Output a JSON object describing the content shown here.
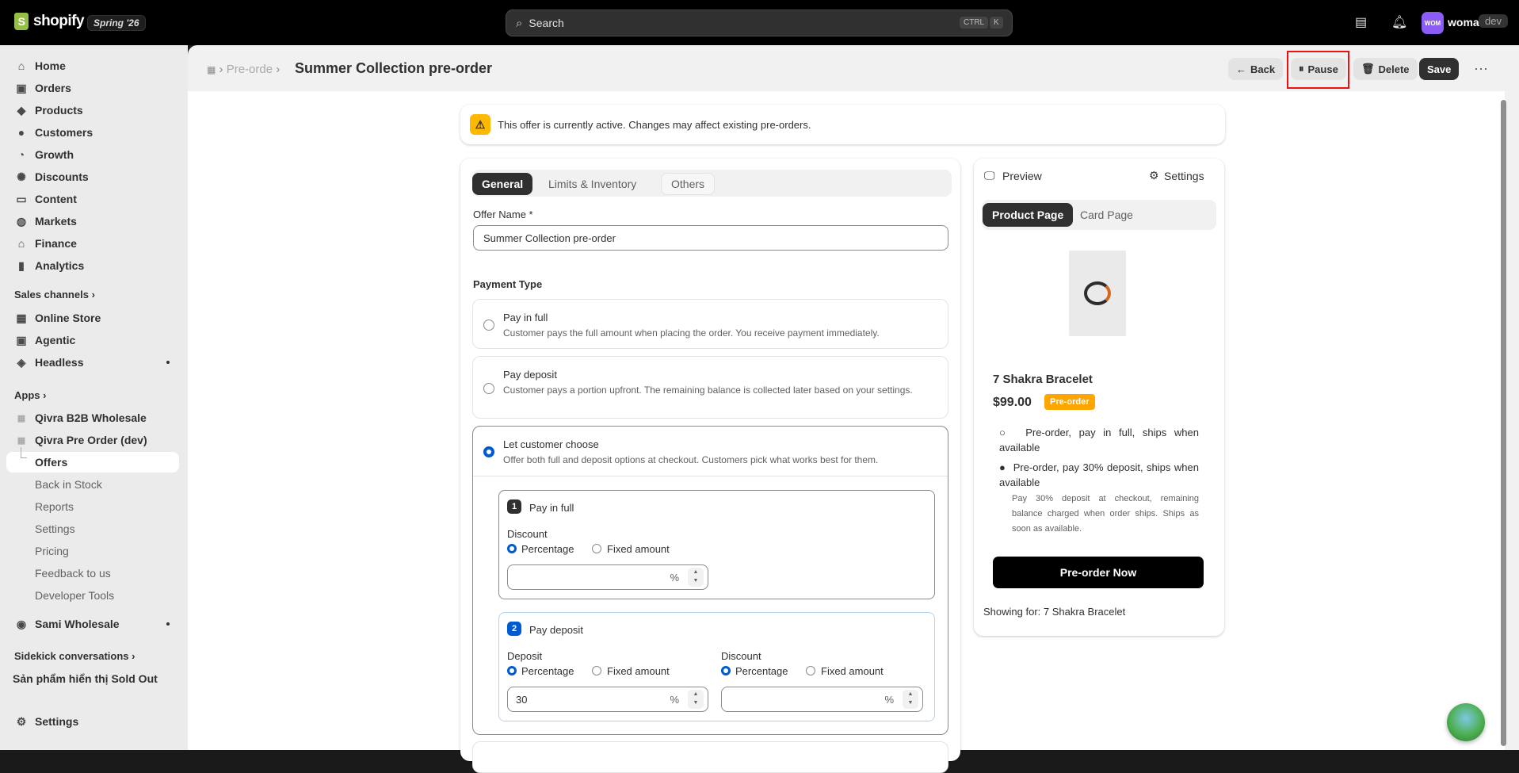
{
  "topbar": {
    "brand": "shopify",
    "edition": "Spring '26",
    "search_placeholder": "Search",
    "kbd_ctrl": "CTRL",
    "kbd_k": "K",
    "avatar_initials": "WOM",
    "store_name": "woma",
    "env": "dev"
  },
  "sidebar": {
    "main": [
      "Home",
      "Orders",
      "Products",
      "Customers",
      "Growth",
      "Discounts",
      "Content",
      "Markets",
      "Finance",
      "Analytics"
    ],
    "sales_channels_label": "Sales channels",
    "channels": [
      "Online Store",
      "Agentic",
      "Headless"
    ],
    "apps_label": "Apps",
    "apps": [
      "Qivra B2B Wholesale",
      "Qivra Pre Order (dev)"
    ],
    "app_sub": [
      "Offers",
      "Back in Stock",
      "Reports",
      "Settings",
      "Pricing",
      "Feedback to us",
      "Developer Tools"
    ],
    "other_app": "Sami Wholesale",
    "sidekick_label": "Sidekick conversations",
    "sidekick_item": "Sản phẩm hiển thị Sold Out",
    "settings": "Settings"
  },
  "header": {
    "crumb": "Pre-orde",
    "title": "Summer Collection pre-order",
    "back": "Back",
    "pause": "Pause",
    "delete": "Delete",
    "save": "Save"
  },
  "banner": "This offer is currently active. Changes may affect existing pre-orders.",
  "form": {
    "tabs": [
      "General",
      "Limits & Inventory",
      "Others"
    ],
    "offer_name_label": "Offer Name *",
    "offer_name_value": "Summer Collection pre-order",
    "payment_type_label": "Payment Type",
    "options": [
      {
        "title": "Pay in full",
        "desc": "Customer pays the full amount when placing the order. You receive payment immediately."
      },
      {
        "title": "Pay deposit",
        "desc": "Customer pays a portion upfront. The remaining balance is collected later based on your settings."
      },
      {
        "title": "Let customer choose",
        "desc": "Offer both full and deposit options at checkout. Customers pick what works best for them."
      }
    ],
    "full": {
      "num": "1",
      "title": "Pay in full",
      "discount_label": "Discount",
      "percentage": "Percentage",
      "fixed": "Fixed amount",
      "unit": "%"
    },
    "deposit": {
      "num": "2",
      "title": "Pay deposit",
      "deposit_label": "Deposit",
      "deposit_value": "30",
      "discount_label": "Discount",
      "percentage": "Percentage",
      "fixed": "Fixed amount",
      "unit": "%"
    }
  },
  "preview": {
    "title": "Preview",
    "settings": "Settings",
    "tabs": [
      "Product Page",
      "Card Page"
    ],
    "product_name": "7 Shakra Bracelet",
    "price": "$99.00",
    "badge": "Pre-order",
    "option1": "Pre-order, pay in full, ships when available",
    "option2": "Pre-order, pay 30% deposit, ships when available",
    "option2_note": "Pay 30% deposit at checkout, remaining balance charged when order ships. Ships as soon as available.",
    "button": "Pre-order Now",
    "showing": "Showing for: 7 Shakra Bracelet"
  }
}
